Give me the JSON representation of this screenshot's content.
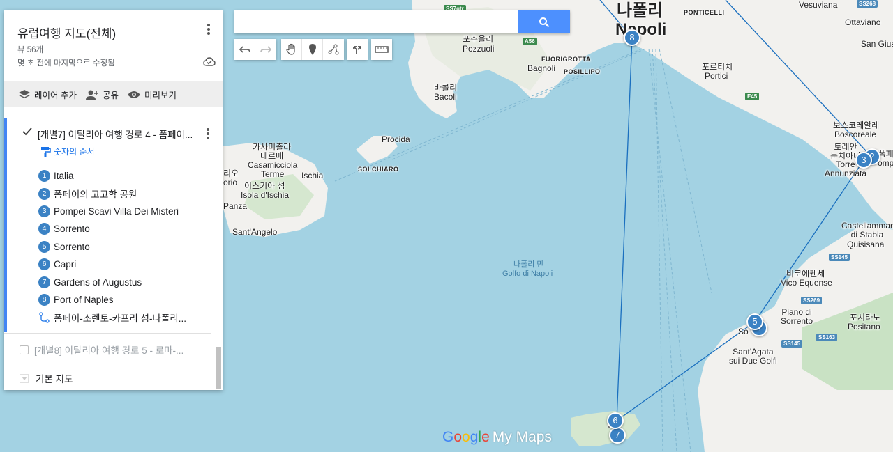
{
  "search": {
    "value": "",
    "placeholder": "",
    "button_icon": "search-icon"
  },
  "toolbar": {
    "icons": [
      "undo-icon",
      "redo-icon",
      "hand-icon",
      "add-marker-icon",
      "draw-line-icon",
      "directions-icon",
      "ruler-icon"
    ]
  },
  "panel": {
    "title": "유럽여행 지도(전체)",
    "views": "뷰 56개",
    "modified": "몇 초 전에 마지막으로 수정됨",
    "actions": [
      {
        "icon": "layers-icon",
        "label": "레이어 추가"
      },
      {
        "icon": "share-icon",
        "label": "공유"
      },
      {
        "icon": "eye-icon",
        "label": "미리보기"
      }
    ],
    "layer1": {
      "title": "[개별7] 이탈리아 여행 경로 4 - 폼페이...",
      "checked": true,
      "sort_label": "숫자의 순서",
      "items": [
        {
          "num": "1",
          "label": "Italia"
        },
        {
          "num": "2",
          "label": "폼페이의 고고학 공원"
        },
        {
          "num": "3",
          "label": "Pompei Scavi Villa Dei Misteri"
        },
        {
          "num": "4",
          "label": "Sorrento"
        },
        {
          "num": "5",
          "label": "Sorrento"
        },
        {
          "num": "6",
          "label": "Capri"
        },
        {
          "num": "7",
          "label": "Gardens of Augustus"
        },
        {
          "num": "8",
          "label": "Port of Naples"
        }
      ],
      "route_label": "폼페이-소렌토-카프리 섬-나폴리..."
    },
    "layer2": {
      "title": "[개별8] 이탈리아 여행 경로 5 - 로마-...",
      "checked": false
    },
    "basemap_label": "기본 지도"
  },
  "map": {
    "labels": {
      "napoli_ko": "나폴리",
      "napoli": "Napoli",
      "ponticelli": "PONTICELLI",
      "vesuviana": "Vesuviana",
      "ottaviano": "Ottaviano",
      "san_gius": "San Gius",
      "pozzuoli_ko": "포추올리",
      "pozzuoli": "Pozzuoli",
      "fuorigrotta": "FUORIGROTTA",
      "bagnoli": "Bagnoli",
      "posillipo": "POSILLIPO",
      "portici_ko": "포르티치",
      "portici": "Portici",
      "bacoli_ko": "바콜리",
      "bacoli": "Bacoli",
      "procida": "Procida",
      "solchiaro": "SOLCHIARO",
      "casamicciola_ko": "카사미촐라\n테르메",
      "casamicciola": "Casamicciola\nTerme",
      "ischia": "Ischia",
      "ischia_isola_ko": "이스키아 섬",
      "ischia_isola": "Isola d'Ischia",
      "rio": "리오\norio",
      "panza": "Panza",
      "santangelo": "Sant'Angelo",
      "gulf_ko": "나폴리 만",
      "gulf": "Golfo di Napoli",
      "boscoreale_ko": "보스코레알레",
      "boscoreale": "Boscoreale",
      "torre_ko": "토레안\n눈치아타",
      "torre": "Torre\nAnnunziata",
      "pompei_partial": "폼페\nomp",
      "castellammare": "Castellammar\ndi Stabia",
      "quisisana": "Quisisana",
      "vico_ko": "비코에퀜세",
      "vico": "Vico Equense",
      "piano": "Piano di\nSorrento",
      "positano_ko": "포시타노",
      "positano": "Positano",
      "sorrento_partial": "So",
      "santagata": "Sant'Agata\nsui Due Golfi",
      "capri_partial": "리"
    },
    "road_shields": [
      "SS7qtr",
      "A56",
      "E45",
      "SS145",
      "SS269",
      "SS163",
      "SS145",
      "SS268"
    ],
    "markers": [
      {
        "num": "8",
        "name": "Port of Naples"
      },
      {
        "num": "3",
        "name": "Pompei Scavi Villa Dei Misteri"
      },
      {
        "num": "2",
        "name": "폼페이의 고고학 공원"
      },
      {
        "num": "5",
        "name": "Sorrento"
      },
      {
        "num": "4",
        "name": "Sorrento"
      },
      {
        "num": "6",
        "name": "Capri"
      },
      {
        "num": "7",
        "name": "Gardens of Augustus"
      }
    ],
    "brand": {
      "google": [
        "G",
        "o",
        "o",
        "g",
        "l",
        "e"
      ],
      "mymaps": "My Maps"
    }
  },
  "colors": {
    "water": "#a3d2e3",
    "land": "#f2f1ee",
    "green": "#c9e2c4",
    "route": "#1a6fbf",
    "marker": "#3b82c4",
    "search_button": "#4d90fe",
    "layer_accent": "#4285f4"
  }
}
